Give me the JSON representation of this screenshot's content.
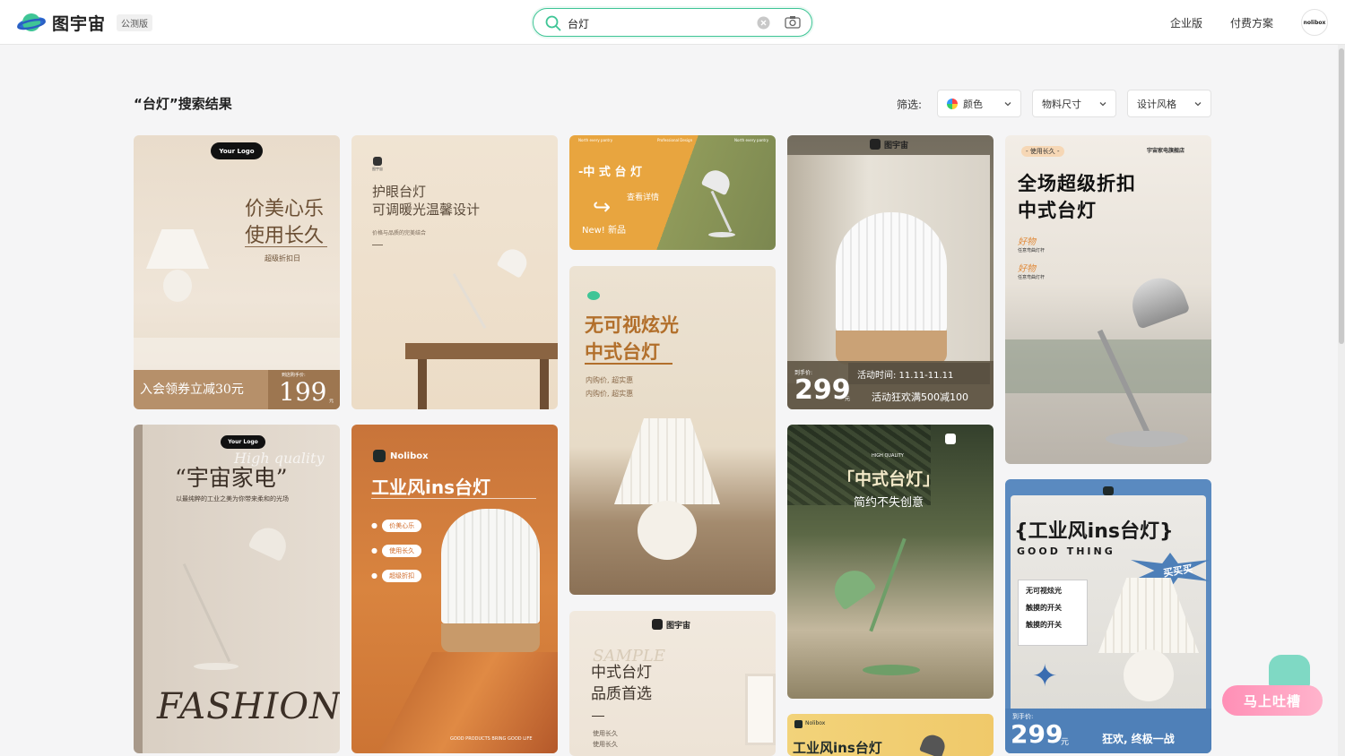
{
  "header": {
    "logo_text": "图宇宙",
    "beta_badge": "公测版",
    "search": {
      "value": "台灯",
      "placeholder": ""
    },
    "nav": {
      "enterprise": "企业版",
      "pricing": "付费方案"
    },
    "avatar_text": "nolibox"
  },
  "toolbar": {
    "results_title": "“台灯”搜索结果",
    "filter_label": "筛选:",
    "filters": [
      "颜色",
      "物料尺寸",
      "设计风格"
    ]
  },
  "cards": {
    "c1": {
      "logo": "Your Logo",
      "line1": "价美心乐",
      "line2": "使用长久",
      "tag": "超级折扣日",
      "coupon": "入会领券立减30元",
      "price_label": "到店购手价:",
      "price": "199",
      "unit": "元"
    },
    "c2": {
      "line1": "护眼台灯",
      "line2": "可调暖光温馨设计",
      "sub": "价格与品质的完美结合",
      "logo_mini": "图宇宙"
    },
    "c3": {
      "title": "-中 式 台 灯",
      "link": "查看详情",
      "new": "New! 新品",
      "top1": "North every pantry",
      "top2": "Professional Design",
      "top3": "North every pantry"
    },
    "c4": {
      "brand": "图宇宙",
      "label": "到手价:",
      "price": "299",
      "unit": "元",
      "time": "活动时间: 11.11-11.11",
      "promo": "活动狂欢满500减100"
    },
    "c5": {
      "tag": "- 使用长久 -",
      "shop": "宇宙家电旗舰店",
      "line1": "全场超级折扣",
      "line2": "中式台灯",
      "good1": "好物",
      "sub1": "任意弯曲灯杆",
      "good2": "好物",
      "sub2": "任意弯曲灯杆"
    },
    "c6": {
      "line1": "无可视炫光",
      "line2": "中式台灯",
      "sub1": "内购价, 超实惠",
      "sub2": "内购价, 超实惠"
    },
    "c7": {
      "logo": "Your Logo",
      "watermark": "High quality",
      "title": "“宇宙家电”",
      "sub": "以最纯粹的工业之美为你带来柔和的光场",
      "fashion": "FASHION"
    },
    "c8": {
      "brand": "Nolibox",
      "title": "工业风ins台灯",
      "tags": [
        "价美心乐",
        "使用长久",
        "超级折扣"
      ],
      "footer": "GOOD PRODUCTS BRING GOOD LIFE"
    },
    "c9": {
      "small": "HIGH QUALITY",
      "line1": "「中式台灯」",
      "line2": "简约不失创意"
    },
    "c10": {
      "brand": "图宇宙",
      "script": "SAMPLE",
      "line1": "中式台灯",
      "line2": "品质首选",
      "sub1": "使用长久",
      "sub2": "使用长久"
    },
    "c11": {
      "title": "{工业风ins台灯}",
      "sub": "GOOD THING",
      "burst": "买买买",
      "list": [
        "无可视炫光",
        "触摸的开关",
        "触摸的开关"
      ],
      "label": "到手价:",
      "price": "299",
      "unit": "元",
      "slogan": "狂欢, 终极一战"
    },
    "c12": {
      "brand": "Nolibox",
      "title": "工业风ins台灯"
    }
  },
  "feedback": {
    "label": "马上吐槽"
  },
  "colors": {
    "accent": "#3fc596",
    "orange": "#d9822b",
    "olive": "#7b8750",
    "blue": "#5a8ac0"
  }
}
